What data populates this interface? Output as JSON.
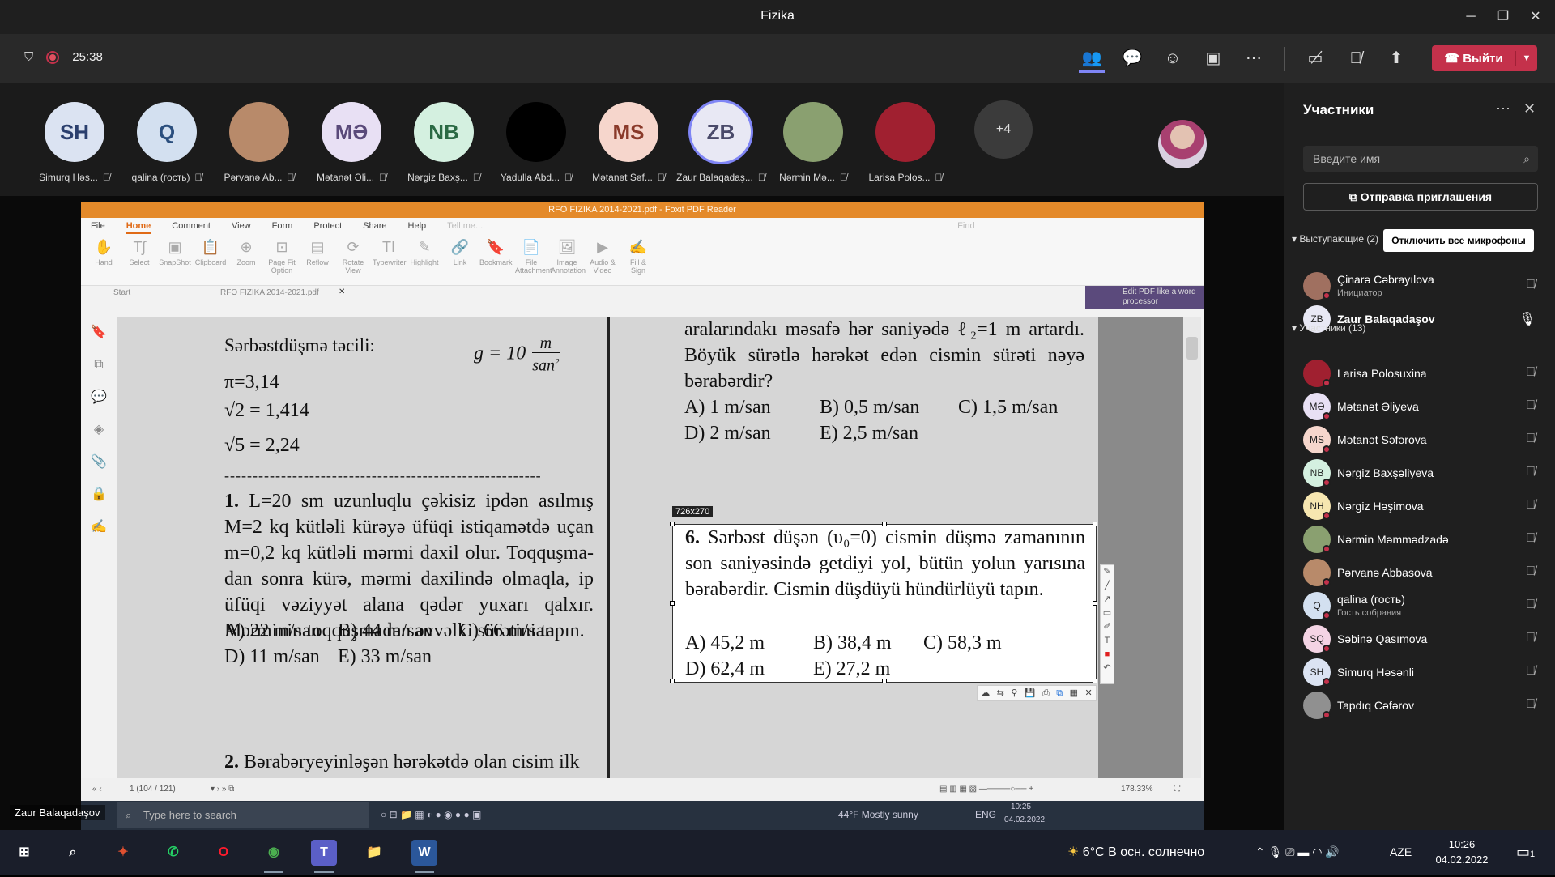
{
  "window": {
    "title": "Fizika"
  },
  "toolbar": {
    "timer": "25:38",
    "leave_label": "Выйти"
  },
  "strip": {
    "participants": [
      {
        "name": "Simurq Həs...",
        "initials": "SH",
        "bg": "#dbe3f2",
        "fg": "#2b3f6e"
      },
      {
        "name": "qalina (гость)",
        "initials": "Q",
        "bg": "#d3e0f0",
        "fg": "#2b4f7e"
      },
      {
        "name": "Pərvanə Ab...",
        "initials": "",
        "bg": "#b88a6a",
        "fg": "#fff"
      },
      {
        "name": "Mətanət Əli...",
        "initials": "MƏ",
        "bg": "#e8e0f4",
        "fg": "#5a4a7a"
      },
      {
        "name": "Nərgiz Baxş...",
        "initials": "NB",
        "bg": "#d4f0e0",
        "fg": "#2a6a44"
      },
      {
        "name": "Yadulla Abd...",
        "initials": "",
        "bg": "#000000",
        "fg": "#fff"
      },
      {
        "name": "Mətanət Səf...",
        "initials": "MS",
        "bg": "#f6d6cc",
        "fg": "#8a3a2a"
      },
      {
        "name": "Zaur Balaqadaş...",
        "initials": "ZB",
        "bg": "#e8e8f4",
        "fg": "#4a4a6a"
      },
      {
        "name": "Nərmin Mə...",
        "initials": "",
        "bg": "#8aa070",
        "fg": "#fff"
      },
      {
        "name": "Larisa Polos...",
        "initials": "",
        "bg": "#a02030",
        "fg": "#fff"
      }
    ],
    "more": "+4"
  },
  "pdf": {
    "title": "RFO FIZIKA 2014-2021.pdf - Foxit PDF Reader",
    "tabs": [
      "File",
      "Home",
      "Comment",
      "View",
      "Form",
      "Protect",
      "Share",
      "Help"
    ],
    "tell_me": "Tell me...",
    "find": "Find",
    "ribbon": [
      {
        "icon": "hand",
        "label": "Hand"
      },
      {
        "icon": "T",
        "label": "Select"
      },
      {
        "icon": "snap",
        "label": "SnapShot"
      },
      {
        "icon": "clip",
        "label": "Clipboard"
      },
      {
        "icon": "zoom",
        "label": "Zoom"
      },
      {
        "icon": "fit",
        "label": "Page Fit Option"
      },
      {
        "icon": "reflow",
        "label": "Reflow"
      },
      {
        "icon": "rotate",
        "label": "Rotate View"
      },
      {
        "icon": "TI",
        "label": "Typewriter"
      },
      {
        "icon": "hl",
        "label": "Highlight"
      },
      {
        "icon": "link",
        "label": "Link"
      },
      {
        "icon": "bm",
        "label": "Bookmark"
      },
      {
        "icon": "file",
        "label": "File Attachment"
      },
      {
        "icon": "img",
        "label": "Image Annotation"
      },
      {
        "icon": "av",
        "label": "Audio & Video"
      },
      {
        "icon": "sign",
        "label": "Fill & Sign"
      }
    ],
    "doc_tabs": {
      "start": "Start",
      "file": "RFO FIZIKA 2014-2021.pdf"
    },
    "edit_tag": "Edit PDF like a word processor",
    "page_nav": "1 (104 / 121)",
    "zoom": "178.33%",
    "selection_size": "726x270"
  },
  "doc": {
    "freefall": "Sərbəstdüşmə təcili:",
    "g_lhs": "g = 10",
    "g_num": "m",
    "g_den": "san",
    "g_exp": "2",
    "pi": "π=3,14",
    "sqrt2": "√2 = 1,414",
    "sqrt5": "√5 = 2,24",
    "dashes": "--------------------------------------------------------",
    "q1_num": "1.",
    "q1_text": "L=20 sm uzunluqlu çəkisiz ipdən asılmış M=2 kq kütləli kürəyə üfüqi istiqamətdə uçan m=0,2 kq kütləli mərmi daxil olur. Toqquşma­dan sonra kürə, mərmi daxilində olmaqla, ip üfüqi vəziyyət alana qədər yuxarı qalxır. Mərminin toqquşmadan əvvəlki sürətini tapın.",
    "q1_a1": "A) 22 m/san",
    "q1_b1": "B) 44 m/san",
    "q1_c1": "C) 66 m/san",
    "q1_d1": "D) 11 m/san",
    "q1_e1": "E) 33 m/san",
    "q2_num": "2.",
    "q2_text": "Bərabəryeyinləşən hərəkətdə olan cisim ilk",
    "r_text": "aralarındakı məsafə hər saniyədə ℓ₂=1 m artardı. Böyük sürətlə hərəkət edən cismin sürəti nəyə bərabərdir?",
    "r_a": "A) 1 m/san",
    "r_b": "B) 0,5 m/san",
    "r_c": "C) 1,5 m/san",
    "r_d": "D) 2 m/san",
    "r_e": "E) 2,5 m/san",
    "q6_num": "6.",
    "q6_text": "Sərbəst düşən (υ₀=0) cismin düşmə zamanının son saniyəsində getdiyi yol, bütün yolun yarısına bərabərdir. Cismin düşdüyü hündürlüyü tapın.",
    "q6_a": "A) 45,2 m",
    "q6_b": "B) 38,4 m",
    "q6_c": "C) 58,3 m",
    "q6_d": "D) 62,4 m",
    "q6_e": "E) 27,2 m"
  },
  "remote_taskbar": {
    "search": "Type here to search",
    "weather": "44°F  Mostly sunny",
    "lang": "ENG",
    "time": "10:25",
    "date": "04.02.2022"
  },
  "presenter_tag": "Zaur Balaqadaşov",
  "panel": {
    "title": "Участники",
    "search_placeholder": "Введите имя",
    "invite": "Отправка приглашения",
    "presenters_label": "Выступающие (2)",
    "mute_all": "Отключить все микрофоны",
    "attendees_label": "Участники (13)",
    "presenters": [
      {
        "name": "Çinarə Cəbrayılova",
        "sub": "Инициатор",
        "initials": "",
        "bg": "#a07060"
      },
      {
        "name": "Zaur Balaqadaşov",
        "sub": "",
        "initials": "ZB",
        "bg": "#e8e8f4"
      }
    ],
    "attendees": [
      {
        "name": "Larisa Polosuxina",
        "sub": "",
        "initials": "",
        "bg": "#a02030"
      },
      {
        "name": "Mətanət Əliyeva",
        "sub": "",
        "initials": "MƏ",
        "bg": "#e8e0f4"
      },
      {
        "name": "Mətanət Səfərova",
        "sub": "",
        "initials": "MS",
        "bg": "#f6d6cc"
      },
      {
        "name": "Nərgiz Baxşəliyeva",
        "sub": "",
        "initials": "NB",
        "bg": "#d4f0e0"
      },
      {
        "name": "Nərgiz Həşimova",
        "sub": "",
        "initials": "NH",
        "bg": "#f6e6b0"
      },
      {
        "name": "Nərmin Məmmədzadə",
        "sub": "",
        "initials": "",
        "bg": "#8aa070"
      },
      {
        "name": "Pərvanə Abbasova",
        "sub": "",
        "initials": "",
        "bg": "#b88a6a"
      },
      {
        "name": "qalina (гость)",
        "sub": "Гость собрания",
        "initials": "Q",
        "bg": "#d3e0f0"
      },
      {
        "name": "Səbinə Qasımova",
        "sub": "",
        "initials": "SQ",
        "bg": "#f4d4e4"
      },
      {
        "name": "Simurq Həsənli",
        "sub": "",
        "initials": "SH",
        "bg": "#dbe3f2"
      },
      {
        "name": "Tapdıq Cəfərov",
        "sub": "",
        "initials": "",
        "bg": "#909090"
      }
    ]
  },
  "taskbar": {
    "weather": "6°C  В осн. солнечно",
    "lang": "AZE",
    "time": "10:26",
    "date": "04.02.2022",
    "notif": "1"
  }
}
